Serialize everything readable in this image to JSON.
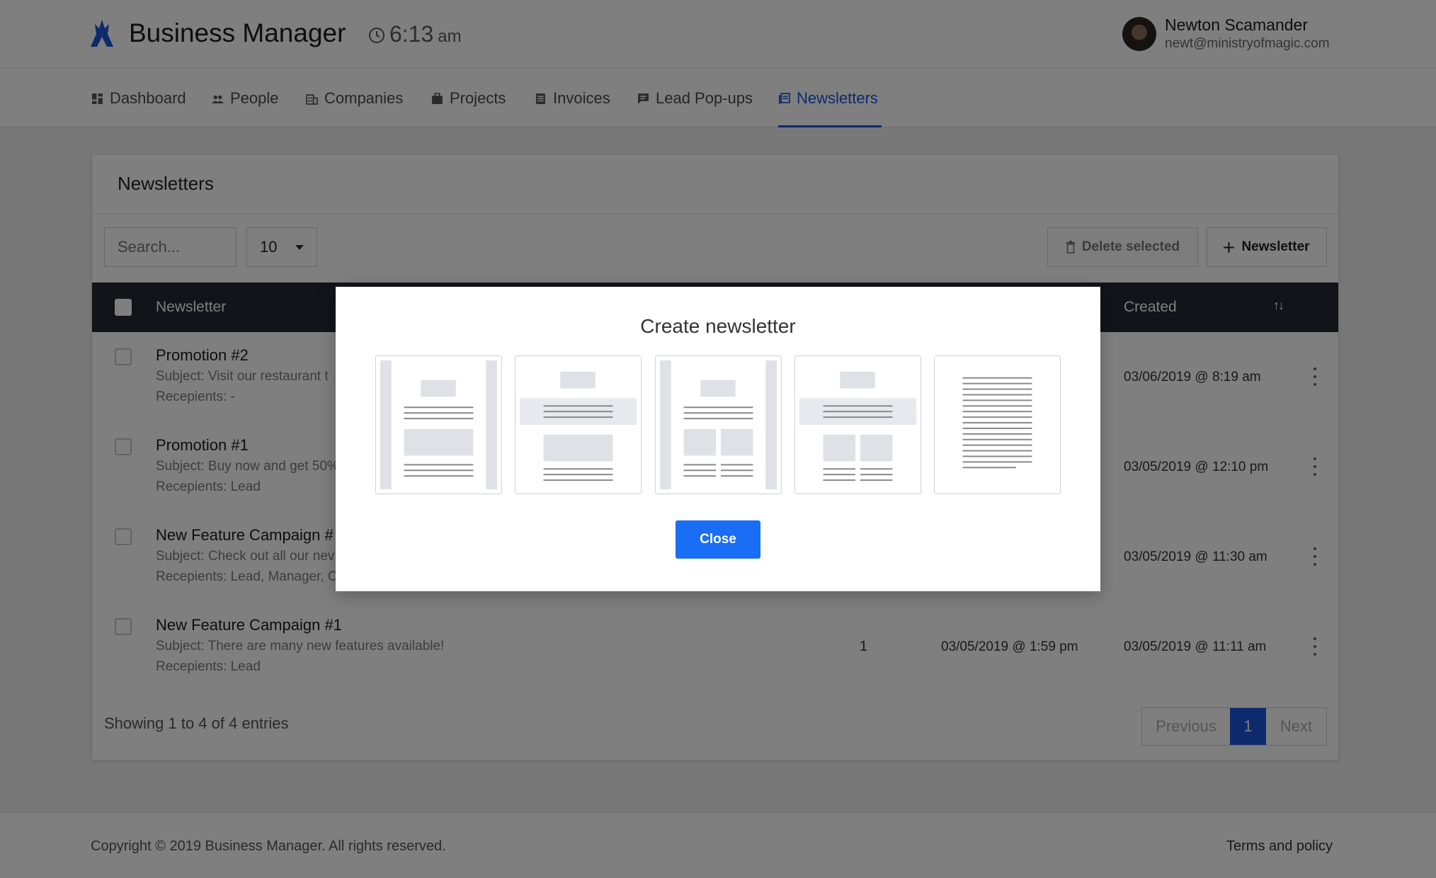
{
  "header": {
    "app_title": "Business Manager",
    "time": "6:13",
    "ampm": "am",
    "user_name": "Newton Scamander",
    "user_email": "newt@ministryofmagic.com"
  },
  "nav": {
    "items": [
      {
        "label": "Dashboard",
        "icon": "dashboard-icon"
      },
      {
        "label": "People",
        "icon": "people-icon"
      },
      {
        "label": "Companies",
        "icon": "companies-icon"
      },
      {
        "label": "Projects",
        "icon": "projects-icon"
      },
      {
        "label": "Invoices",
        "icon": "invoices-icon"
      },
      {
        "label": "Lead Pop-ups",
        "icon": "lead-popups-icon"
      },
      {
        "label": "Newsletters",
        "icon": "newsletters-icon"
      }
    ],
    "active": "Newsletters"
  },
  "card": {
    "title": "Newsletters",
    "search_placeholder": "Search...",
    "page_size": "10",
    "delete_label": "Delete selected",
    "new_label": "Newsletter",
    "columns": {
      "newsletter": "Newsletter",
      "created": "Created"
    },
    "rows": [
      {
        "title": "Promotion #2",
        "subject": "Subject: Visit our restaurant t",
        "recipients": "Recepients: -",
        "count": "",
        "sent": "",
        "created": "03/06/2019 @ 8:19 am"
      },
      {
        "title": "Promotion #1",
        "subject": "Subject: Buy now and get 50%",
        "recipients": "Recepients: Lead",
        "count": "",
        "sent": "",
        "created": "03/05/2019 @ 12:10 pm"
      },
      {
        "title": "New Feature Campaign #",
        "subject": "Subject: Check out all our nev",
        "recipients": "Recepients: Lead, Manager, C",
        "count": "",
        "sent": "",
        "created": "03/05/2019 @ 11:30 am"
      },
      {
        "title": "New Feature Campaign #1",
        "subject": "Subject: There are many new features available!",
        "recipients": "Recepients: Lead",
        "count": "1",
        "sent": "03/05/2019 @ 1:59 pm",
        "created": "03/05/2019 @ 11:11 am"
      }
    ],
    "showing": "Showing 1 to 4 of 4 entries",
    "pager": {
      "prev": "Previous",
      "current": "1",
      "next": "Next"
    }
  },
  "modal": {
    "title": "Create newsletter",
    "templates": [
      "template-sidebar-single",
      "template-banner-single",
      "template-sidebar-two-column",
      "template-banner-two-column",
      "template-plain-text"
    ],
    "close_label": "Close"
  },
  "footer": {
    "copyright": "Copyright © 2019 Business Manager. All rights reserved.",
    "terms": "Terms and policy"
  },
  "colors": {
    "accent": "#1a55d8",
    "close_button": "#1a6ef5",
    "table_header": "#262932",
    "overlay": "rgba(0,0,0,0.5)"
  }
}
